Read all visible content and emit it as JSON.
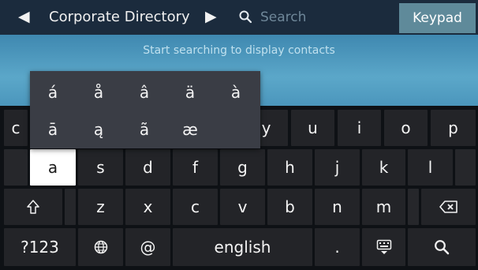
{
  "header": {
    "title": "Corporate Directory",
    "search_placeholder": "Search",
    "keypad_label": "Keypad"
  },
  "banner": {
    "message": "Start searching to display contacts"
  },
  "keyboard": {
    "row1": [
      "c",
      "y",
      "u",
      "i",
      "o",
      "p"
    ],
    "row2": [
      "a",
      "s",
      "d",
      "f",
      "g",
      "h",
      "j",
      "k",
      "l"
    ],
    "row3": [
      "z",
      "x",
      "c",
      "v",
      "b",
      "n",
      "m"
    ],
    "row4": {
      "symbols_label": "?123",
      "at_label": "@",
      "space_label": "english",
      "period_label": "."
    },
    "selected_key": "a",
    "accent_popup": {
      "row1": [
        "á",
        "å",
        "â",
        "ä",
        "à"
      ],
      "row2": [
        "ā",
        "ą",
        "ã",
        "æ"
      ]
    }
  }
}
